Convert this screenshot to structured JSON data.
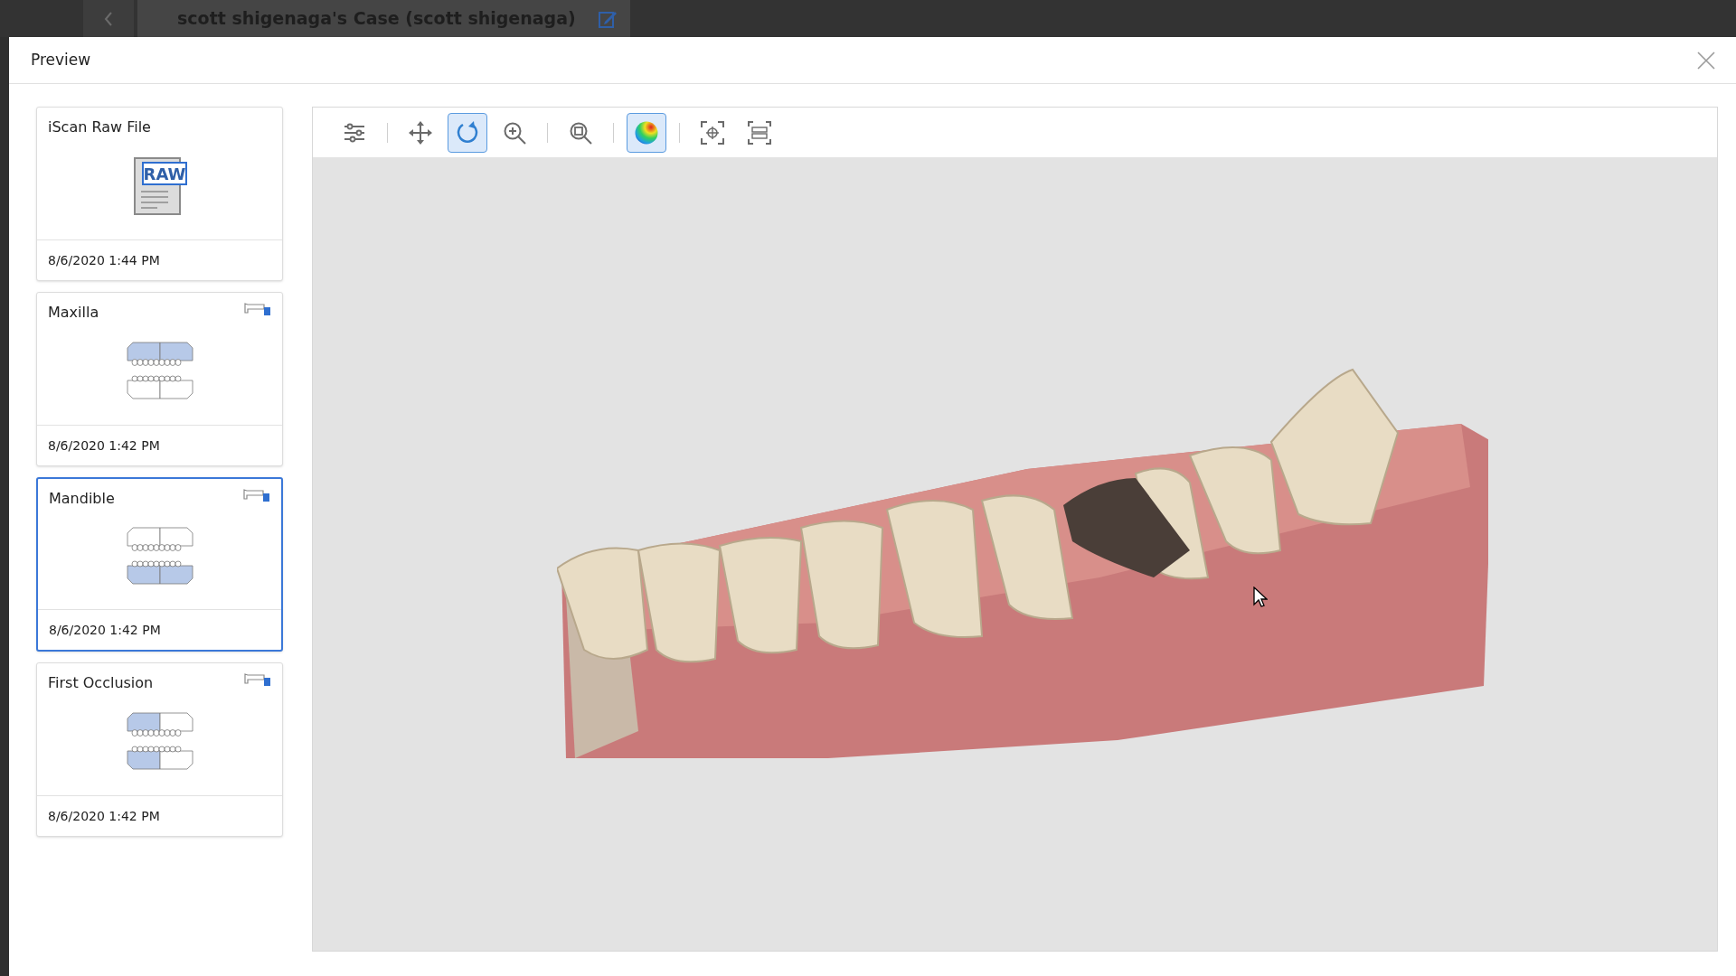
{
  "top_bar": {
    "case_title": "scott shigenaga's Case (scott shigenaga)"
  },
  "dialog": {
    "title": "Preview"
  },
  "files": [
    {
      "name": "iScan Raw File",
      "date": "8/6/2020 1:44 PM",
      "kind": "raw",
      "badge": "RAW",
      "scanner": false,
      "selected": false
    },
    {
      "name": "Maxilla",
      "date": "8/6/2020 1:42 PM",
      "kind": "maxilla",
      "scanner": true,
      "selected": false
    },
    {
      "name": "Mandible",
      "date": "8/6/2020 1:42 PM",
      "kind": "mandible",
      "scanner": true,
      "selected": true
    },
    {
      "name": "First Occlusion",
      "date": "8/6/2020 1:42 PM",
      "kind": "occlusion",
      "scanner": true,
      "selected": false
    }
  ],
  "toolbar": [
    {
      "kind": "settings",
      "selected": false
    },
    {
      "kind": "separator"
    },
    {
      "kind": "pan",
      "selected": false
    },
    {
      "kind": "rotate",
      "selected": true
    },
    {
      "kind": "zoom-in",
      "selected": false
    },
    {
      "kind": "separator"
    },
    {
      "kind": "zoom-fit",
      "selected": false
    },
    {
      "kind": "separator"
    },
    {
      "kind": "color",
      "selected": true
    },
    {
      "kind": "separator"
    },
    {
      "kind": "center",
      "selected": false
    },
    {
      "kind": "fit-model",
      "selected": false
    }
  ]
}
